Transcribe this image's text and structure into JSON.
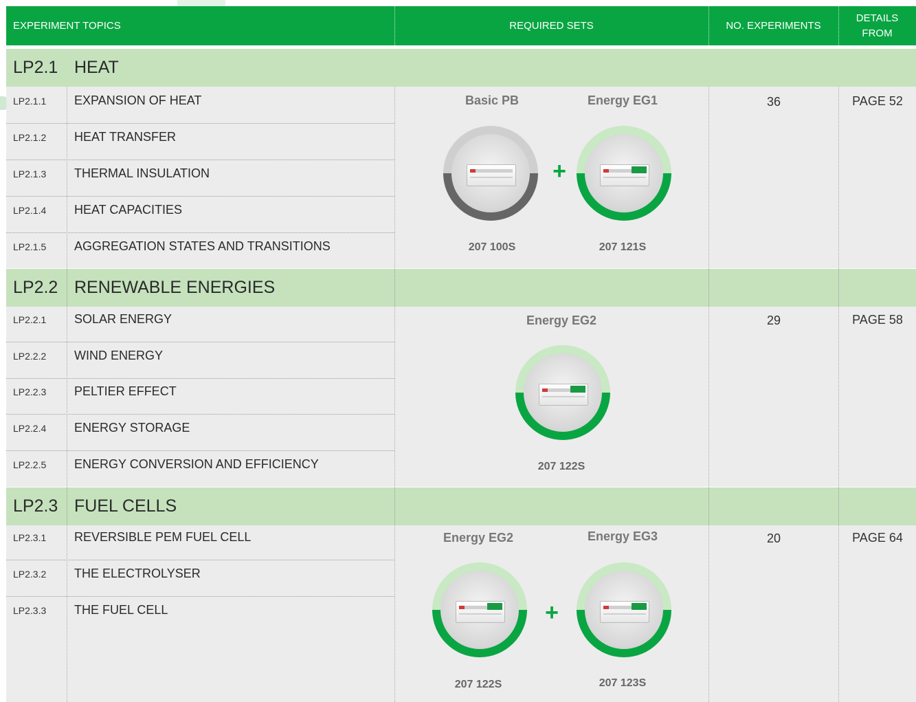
{
  "header": {
    "topics": "EXPERIMENT TOPICS",
    "sets": "REQUIRED SETS",
    "experiments": "NO. EXPERIMENTS",
    "details_line1": "DETAILS",
    "details_line2": "FROM"
  },
  "sections": [
    {
      "code": "LP2.1",
      "title": "HEAT",
      "rows": [
        {
          "code": "LP2.1.1",
          "topic": "EXPANSION OF HEAT"
        },
        {
          "code": "LP2.1.2",
          "topic": "HEAT TRANSFER"
        },
        {
          "code": "LP2.1.3",
          "topic": "THERMAL INSULATION"
        },
        {
          "code": "LP2.1.4",
          "topic": "HEAT CAPACITIES"
        },
        {
          "code": "LP2.1.5",
          "topic": "AGGREGATION STATES AND TRANSITIONS"
        }
      ],
      "sets": [
        {
          "name": "Basic PB",
          "number": "207 100S",
          "ring": "grey"
        },
        {
          "name": "Energy EG1",
          "number": "207 121S",
          "ring": "green"
        }
      ],
      "plus": "+",
      "experiments": "36",
      "details": "PAGE 52"
    },
    {
      "code": "LP2.2",
      "title": "RENEWABLE ENERGIES",
      "rows": [
        {
          "code": "LP2.2.1",
          "topic": "SOLAR ENERGY"
        },
        {
          "code": "LP2.2.2",
          "topic": "WIND ENERGY"
        },
        {
          "code": "LP2.2.3",
          "topic": "PELTIER EFFECT"
        },
        {
          "code": "LP2.2.4",
          "topic": "ENERGY STORAGE"
        },
        {
          "code": "LP2.2.5",
          "topic": "ENERGY CONVERSION AND EFFICIENCY"
        }
      ],
      "sets": [
        {
          "name": "Energy EG2",
          "number": "207 122S",
          "ring": "green"
        }
      ],
      "experiments": "29",
      "details": "PAGE 58"
    },
    {
      "code": "LP2.3",
      "title": "FUEL CELLS",
      "rows": [
        {
          "code": "LP2.3.1",
          "topic": "REVERSIBLE PEM FUEL CELL"
        },
        {
          "code": "LP2.3.2",
          "topic": "THE ELECTROLYSER"
        },
        {
          "code": "LP2.3.3",
          "topic": "THE FUEL CELL"
        }
      ],
      "sets": [
        {
          "name": "Energy EG2",
          "number": "207 122S",
          "ring": "green"
        },
        {
          "name": "Energy EG3",
          "number": "207 123S",
          "ring": "green"
        }
      ],
      "plus": "+",
      "experiments": "20",
      "details": "PAGE 64"
    }
  ],
  "colors": {
    "header": "#0aa543",
    "band": "#c5e2bd",
    "cell": "#ececec",
    "ring_green": "#0aa543",
    "ring_green_light": "#c9e8c4",
    "ring_grey_dark": "#666666",
    "ring_grey_light": "#cfcfcf"
  }
}
